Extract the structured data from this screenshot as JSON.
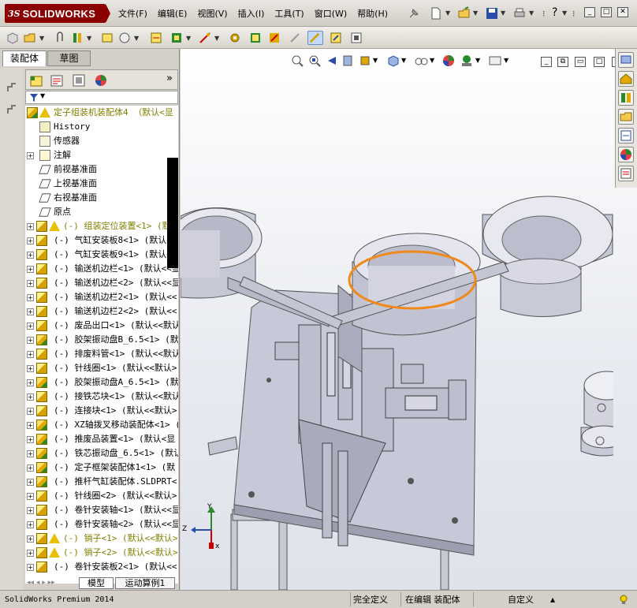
{
  "app": {
    "logo_prefix": "3S",
    "logo_name": "SOLIDWORKS"
  },
  "menu": [
    "文件(F)",
    "编辑(E)",
    "视图(V)",
    "插入(I)",
    "工具(T)",
    "窗口(W)",
    "帮助(H)"
  ],
  "panel_tabs": {
    "assembly": "装配体",
    "sketch": "草图"
  },
  "tree": {
    "root_label": "定子组装机装配体4 （默认<显",
    "items": [
      {
        "label": "History",
        "icon": "history-icon",
        "type": "meta"
      },
      {
        "label": "传感器",
        "icon": "sensor-icon",
        "type": "meta"
      },
      {
        "label": "注解",
        "icon": "annotation-icon",
        "type": "meta-exp"
      },
      {
        "label": "前视基准面",
        "icon": "plane-icon",
        "type": "plane"
      },
      {
        "label": "上视基准面",
        "icon": "plane-icon",
        "type": "plane"
      },
      {
        "label": "右视基准面",
        "icon": "plane-icon",
        "type": "plane"
      },
      {
        "label": "原点",
        "icon": "origin-icon",
        "type": "plane"
      },
      {
        "label": "(-) 组装定位装置<1> (默认",
        "icon": "warning-icon",
        "type": "warn"
      },
      {
        "label": "(-) 气缸安装板8<1> (默认<<",
        "icon": "part-icon",
        "type": "part"
      },
      {
        "label": "(-) 气缸安装板9<1> (默认<<",
        "icon": "part-icon",
        "type": "part"
      },
      {
        "label": "(-) 输送机边栏<1> (默认<<显",
        "icon": "part-icon",
        "type": "part"
      },
      {
        "label": "(-) 输送机边栏<2> (默认<<显",
        "icon": "part-icon",
        "type": "part"
      },
      {
        "label": "(-) 输送机边栏2<1> (默认<<",
        "icon": "part-icon",
        "type": "part"
      },
      {
        "label": "(-) 输送机边栏2<2> (默认<<",
        "icon": "part-icon",
        "type": "part"
      },
      {
        "label": "(-) 废品出口<1> (默认<<默认",
        "icon": "part-icon",
        "type": "part"
      },
      {
        "label": "(-) 胶架振动盘B_6.5<1> (默",
        "icon": "assembly-icon",
        "type": "asm"
      },
      {
        "label": "(-) 排废料管<1> (默认<<默认",
        "icon": "part-icon",
        "type": "part"
      },
      {
        "label": "(-) 针线圈<1> (默认<<默认>",
        "icon": "part-icon",
        "type": "part"
      },
      {
        "label": "(-) 胶架振动盘A_6.5<1> (默",
        "icon": "assembly-icon",
        "type": "asm"
      },
      {
        "label": "(-) 接铁芯块<1> (默认<<默认",
        "icon": "part-icon",
        "type": "part"
      },
      {
        "label": "(-) 连接块<1> (默认<<默认>",
        "icon": "part-icon",
        "type": "part"
      },
      {
        "label": "(-) XZ轴拨叉移动装配体<1> (",
        "icon": "assembly-icon",
        "type": "asm"
      },
      {
        "label": "(-) 推废品装置<1> (默认<显",
        "icon": "assembly-icon",
        "type": "asm"
      },
      {
        "label": "(-) 铁芯振动盘_6.5<1> (默认",
        "icon": "assembly-icon",
        "type": "asm"
      },
      {
        "label": "(-) 定子框架装配体1<1> (默",
        "icon": "assembly-icon",
        "type": "asm"
      },
      {
        "label": "(-) 推杆气缸装配体.SLDPRT<",
        "icon": "assembly-icon",
        "type": "asm"
      },
      {
        "label": "(-) 针线圈<2> (默认<<默认>",
        "icon": "part-icon",
        "type": "part"
      },
      {
        "label": "(-) 卷针安装轴<1> (默认<<显",
        "icon": "part-icon",
        "type": "part"
      },
      {
        "label": "(-) 卷针安装轴<2> (默认<<显",
        "icon": "part-icon",
        "type": "part"
      },
      {
        "label": "(-) 销子<1> (默认<<默认>",
        "icon": "warning-icon",
        "type": "warn"
      },
      {
        "label": "(-) 销子<2> (默认<<默认>",
        "icon": "warning-icon",
        "type": "warn"
      },
      {
        "label": "(-) 卷针安装板2<1> (默认<<",
        "icon": "part-icon",
        "type": "part"
      }
    ]
  },
  "bottom_tabs": {
    "model": "模型",
    "motion": "运动算例1"
  },
  "triad": {
    "x": "x",
    "y": "Y",
    "z": "Z"
  },
  "status": {
    "product": "SolidWorks Premium 2014",
    "defined": "完全定义",
    "editing": "在编辑 装配体",
    "custom": "自定义"
  },
  "colors": {
    "logo_red": "#8b0000",
    "warning_olive": "#808000",
    "highlight_orange": "#ef8a1a"
  }
}
